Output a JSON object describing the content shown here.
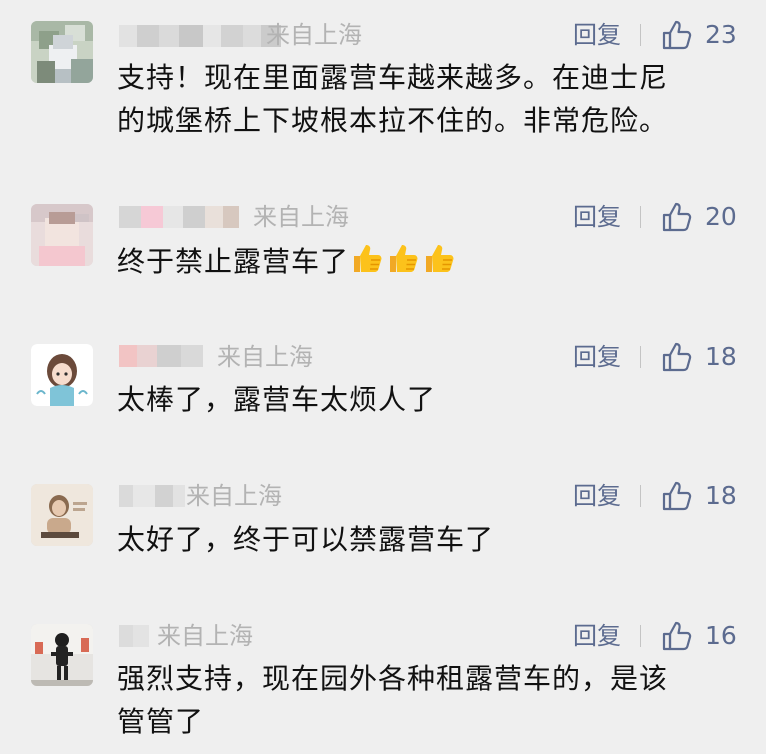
{
  "comments": [
    {
      "region": "来自上海",
      "reply_label": "回复",
      "likes": "23",
      "text_lines": [
        "支持！现在里面露营车越来越多。在迪士尼",
        "的城堡桥上下坡根本拉不住的。非常危险。"
      ]
    },
    {
      "region": "来自上海",
      "reply_label": "回复",
      "likes": "20",
      "text": "终于禁止露营车了",
      "emoji": [
        "thumbs-up-emoji",
        "thumbs-up-emoji",
        "thumbs-up-emoji"
      ]
    },
    {
      "region": "来自上海",
      "reply_label": "回复",
      "likes": "18",
      "text": "太棒了，露营车太烦人了"
    },
    {
      "region": "来自上海",
      "reply_label": "回复",
      "likes": "18",
      "text": "太好了，终于可以禁露营车了"
    },
    {
      "region": "来自上海",
      "reply_label": "回复",
      "likes": "16",
      "text_lines": [
        "强烈支持，现在园外各种租露营车的，是该",
        "管管了"
      ]
    }
  ],
  "colors": {
    "background": "#efefef",
    "link": "#5c6b8f",
    "muted": "#b3b3b3",
    "text": "#111111"
  }
}
